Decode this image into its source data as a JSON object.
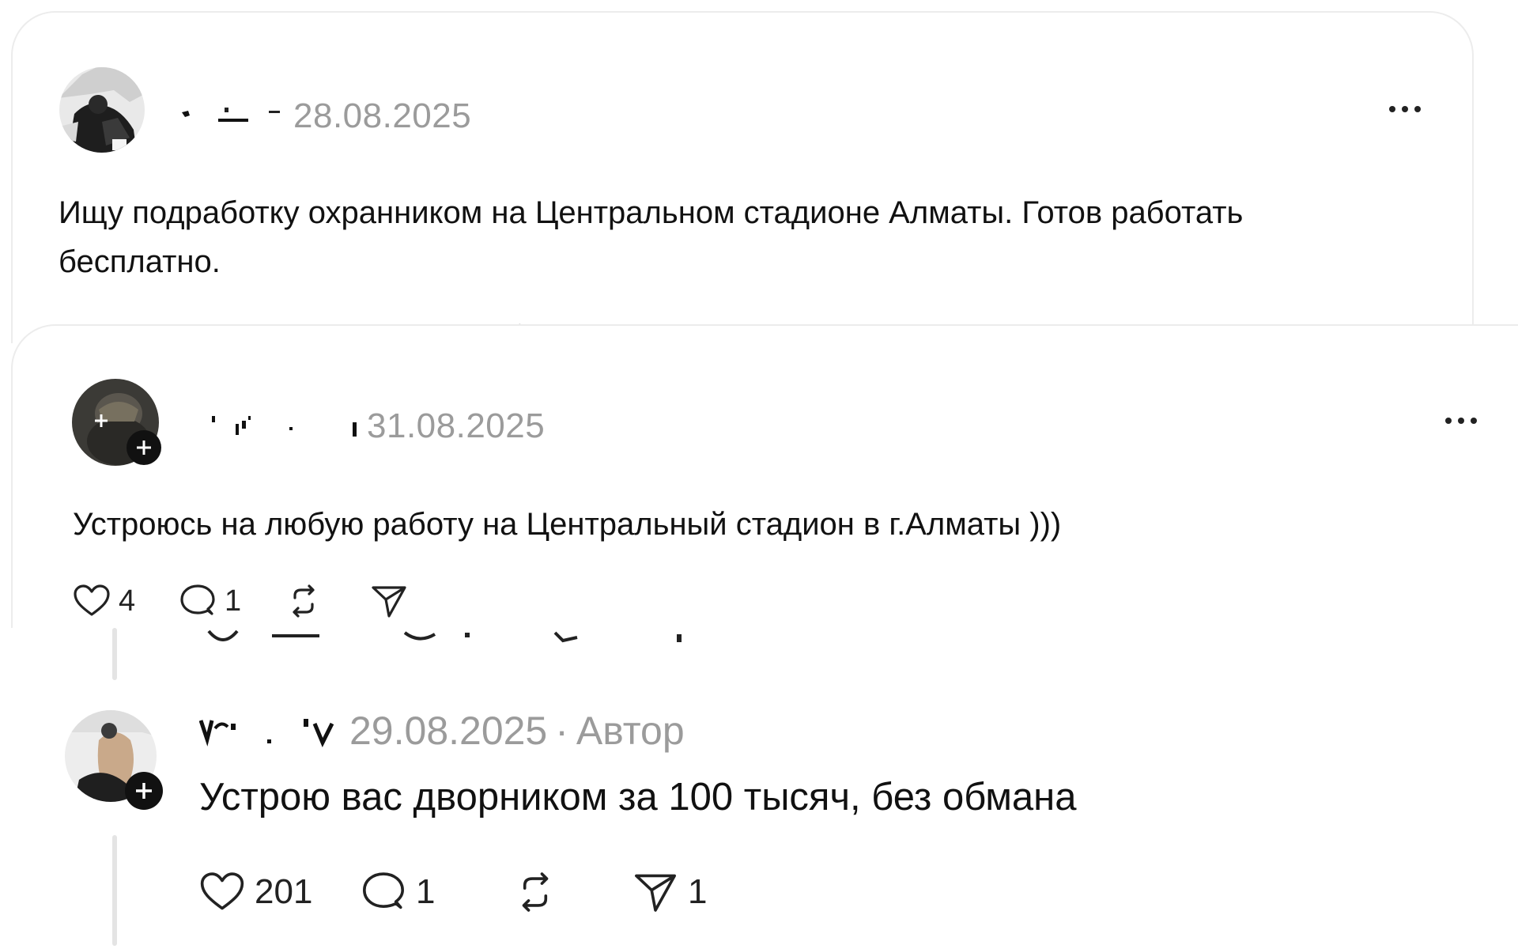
{
  "posts": [
    {
      "date": "28.08.2025",
      "text": "Ищу подработку охранником на Центральном стадионе Алматы. Готов работать бесплатно."
    },
    {
      "date": "31.08.2025",
      "text": "Устроюсь на любую работу на Центральный стадион в г.Алматы )))",
      "actions": {
        "likes": "4",
        "comments": "1",
        "reposts": "",
        "shares": ""
      }
    }
  ],
  "reply": {
    "date": "29.08.2025",
    "separator": "·",
    "badge": "Автор",
    "text": "Устрою вас дворником за 100 тысяч, без обмана",
    "actions": {
      "likes": "201",
      "comments": "1",
      "reposts": "",
      "shares": "1"
    }
  },
  "icons": {
    "more": "more-horizontal-icon",
    "like": "heart-icon",
    "comment": "speech-bubble-icon",
    "repost": "repost-arrows-icon",
    "share": "paper-plane-icon",
    "follow": "plus-badge-icon"
  },
  "colors": {
    "meta_gray": "#9b9b9b",
    "text": "#111111",
    "card_border": "#ececec",
    "thread_line": "#e4e4e4"
  }
}
